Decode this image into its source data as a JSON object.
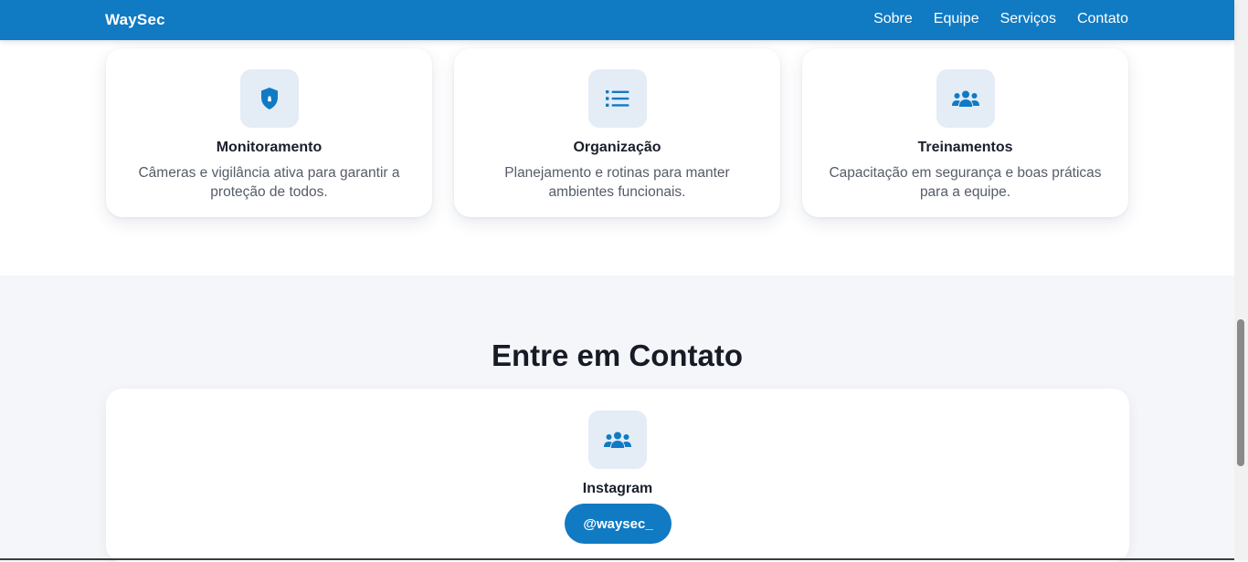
{
  "navbar": {
    "brand": "WaySec",
    "links": [
      "Sobre",
      "Equipe",
      "Serviços",
      "Contato"
    ]
  },
  "services": [
    {
      "icon": "shield-icon",
      "title": "Monitoramento",
      "description": "Câmeras e vigilância ativa para garantir a proteção de todos."
    },
    {
      "icon": "list-icon",
      "title": "Organização",
      "description": "Planejamento e rotinas para manter ambientes funcionais."
    },
    {
      "icon": "users-icon",
      "title": "Treinamentos",
      "description": "Capacitação em segurança e boas práticas para a equipe."
    }
  ],
  "contact": {
    "heading": "Entre em Contato",
    "items": [
      {
        "icon": "users-icon",
        "title": "Instagram",
        "handle": "@waysec_"
      }
    ]
  },
  "colors": {
    "primary": "#107ac3",
    "icon_bg": "#e4ecf6",
    "section_bg": "#f5f6f9",
    "text_dark": "#1a1f2b",
    "text_muted": "#555c68"
  }
}
